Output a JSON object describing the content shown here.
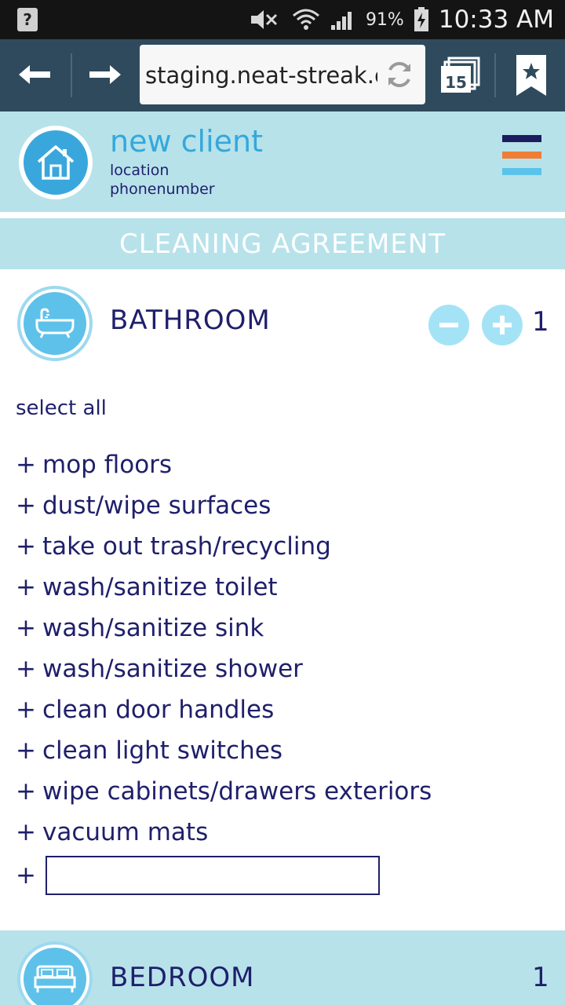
{
  "status_bar": {
    "battery": "91%",
    "time": "10:33 AM"
  },
  "browser": {
    "url": "staging.neat-streak.c",
    "tab_count": "15"
  },
  "client": {
    "name": "new client",
    "location": "location",
    "phone": "phonenumber"
  },
  "menu_colors": [
    "#1c1c5e",
    "#f07d35",
    "#5bc3e9"
  ],
  "agreement_title": "CLEANING AGREEMENT",
  "bathroom": {
    "title": "BATHROOM",
    "count": "1",
    "select_all": "select all",
    "plus_symbol": "+",
    "tasks": [
      "mop floors",
      "dust/wipe surfaces",
      "take out trash/recycling",
      "wash/sanitize toilet",
      "wash/sanitize sink",
      "wash/sanitize shower",
      "clean door handles",
      "clean light switches",
      "wipe cabinets/drawers exteriors",
      "vacuum mats"
    ],
    "custom_task_value": ""
  },
  "bedroom": {
    "title": "BEDROOM",
    "count": "1"
  },
  "colors": {
    "header_bg": "#b7e2ea",
    "navy_text": "#1f1f6b",
    "accent_blue": "#34a8dc",
    "browser_bar": "#2f4a5d"
  }
}
